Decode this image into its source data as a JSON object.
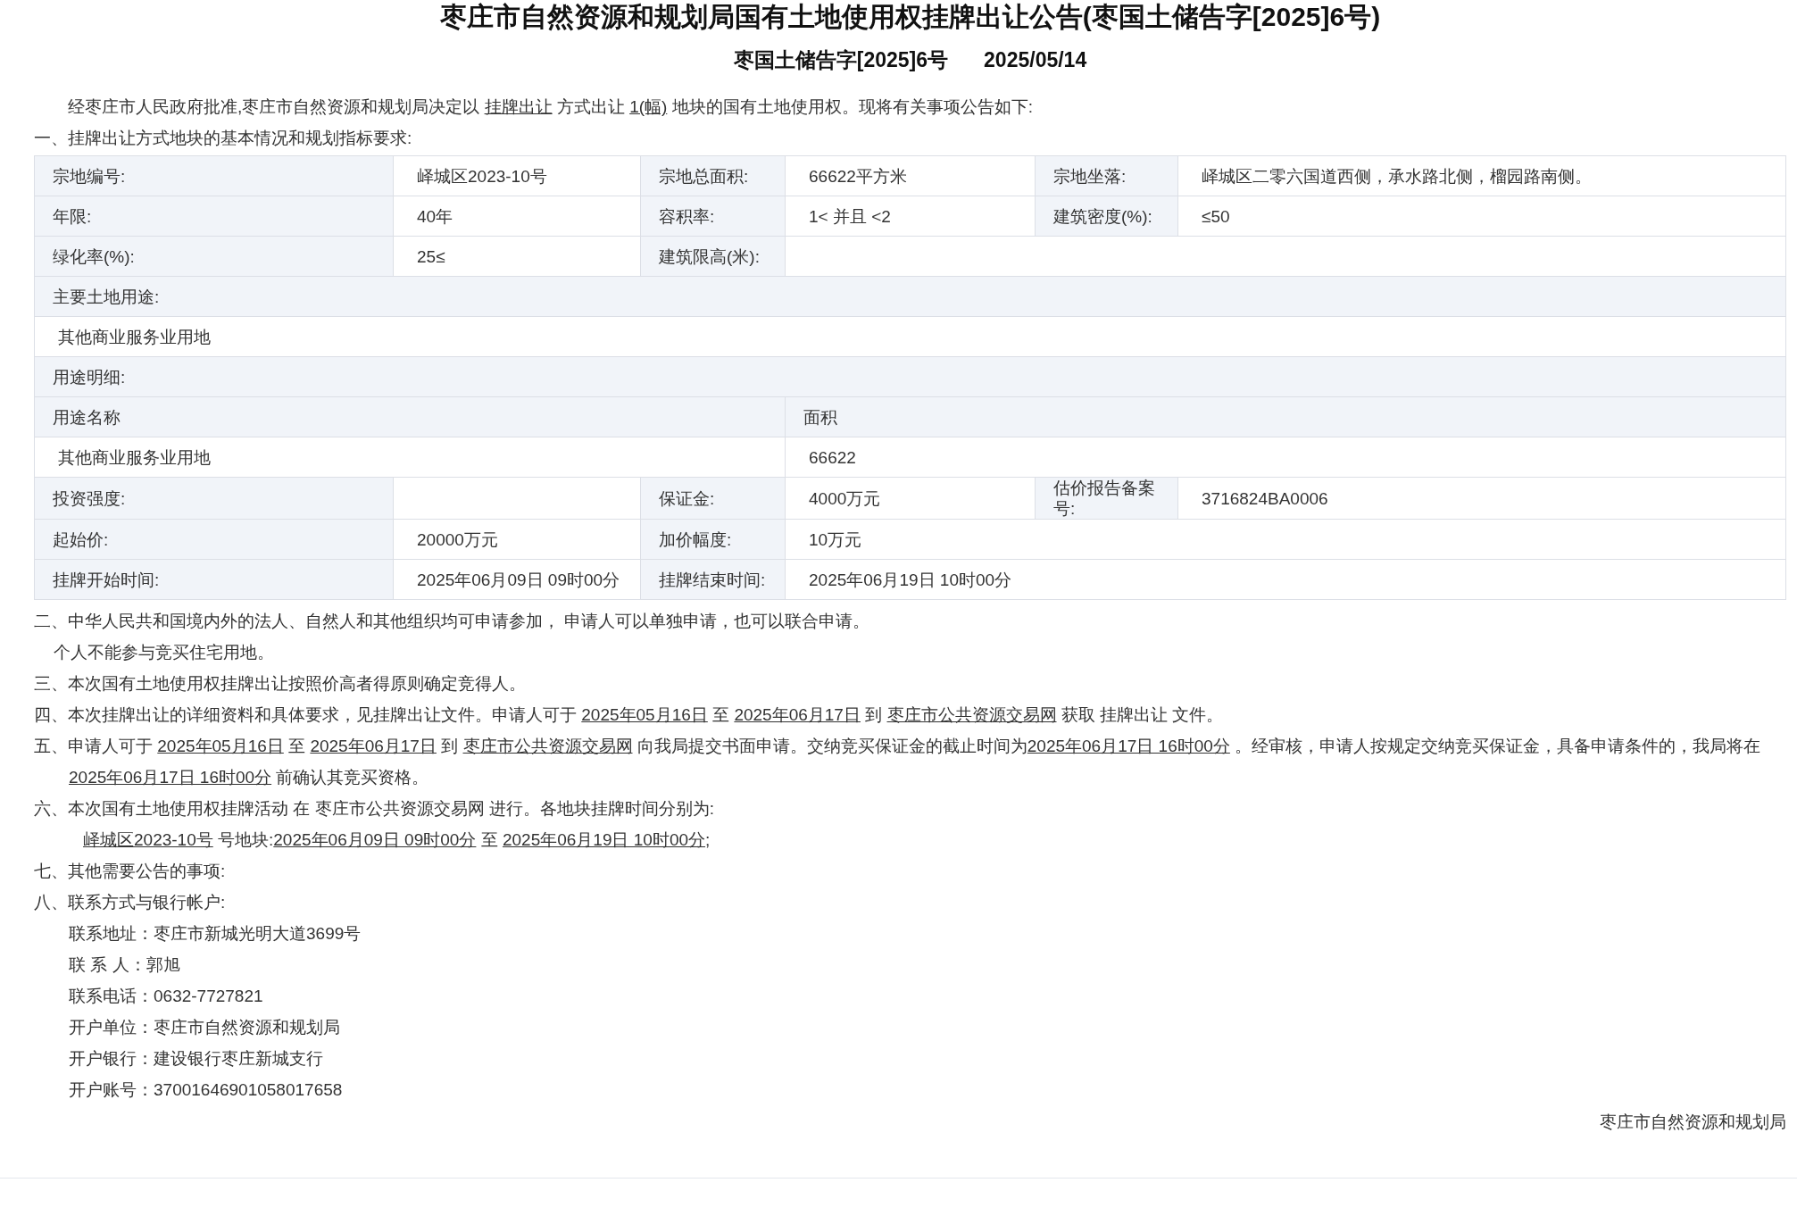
{
  "title": "枣庄市自然资源和规划局国有土地使用权挂牌出让公告(枣国土储告字[2025]6号)",
  "subtitle": {
    "doc_no": "枣国土储告字[2025]6号",
    "date": "2025/05/14"
  },
  "intro": [
    {
      "kind": "plain",
      "text": "经枣庄市人民政府批准,枣庄市自然资源和规划局决定以 "
    },
    {
      "kind": "link",
      "text": "挂牌出让"
    },
    {
      "kind": "plain",
      "text": " 方式出让 "
    },
    {
      "kind": "link",
      "text": "1(幅)"
    },
    {
      "kind": "plain",
      "text": " 地块的国有土地使用权。现将有关事项公告如下:"
    }
  ],
  "section_heading": "一、挂牌出让方式地块的基本情况和规划指标要求:",
  "table": {
    "rows": [
      [
        {
          "kind": "label",
          "text": "宗地编号:"
        },
        {
          "kind": "value",
          "text": "峄城区2023-10号"
        },
        {
          "kind": "label",
          "text": "宗地总面积:"
        },
        {
          "kind": "value",
          "text": "66622平方米"
        },
        {
          "kind": "label",
          "text": "宗地坐落:"
        },
        {
          "kind": "value",
          "text": "峄城区二零六国道西侧，承水路北侧，榴园路南侧。"
        }
      ],
      [
        {
          "kind": "label",
          "text": "年限:"
        },
        {
          "kind": "value",
          "text": "40年"
        },
        {
          "kind": "label",
          "text": "容积率:"
        },
        {
          "kind": "value",
          "text": "1< 并且 <2"
        },
        {
          "kind": "label",
          "text": "建筑密度(%):"
        },
        {
          "kind": "value",
          "text": "≤50"
        }
      ],
      [
        {
          "kind": "label",
          "text": "绿化率(%):"
        },
        {
          "kind": "value",
          "text": "25≤"
        },
        {
          "kind": "label",
          "text": "建筑限高(米):"
        },
        {
          "kind": "value",
          "colspan": 3
        }
      ],
      [
        {
          "kind": "label",
          "text": "主要土地用途:",
          "colspan": 6
        }
      ],
      [
        {
          "kind": "value",
          "text": "其他商业服务业用地",
          "colspan": 6
        }
      ],
      [
        {
          "kind": "label",
          "text": "用途明细:",
          "colspan": 6
        }
      ],
      [
        {
          "kind": "label",
          "text": "用途名称",
          "colspan": 3
        },
        {
          "kind": "label",
          "text": "面积",
          "colspan": 3
        }
      ],
      [
        {
          "kind": "value",
          "text": "其他商业服务业用地",
          "colspan": 3
        },
        {
          "kind": "value",
          "text": "66622",
          "colspan": 3
        }
      ],
      [
        {
          "kind": "label",
          "text": "投资强度:"
        },
        {
          "kind": "value"
        },
        {
          "kind": "label",
          "text": "保证金:"
        },
        {
          "kind": "value",
          "text": "4000万元"
        },
        {
          "kind": "label",
          "text": "估价报告备案号:"
        },
        {
          "kind": "value",
          "text": "3716824BA0006"
        }
      ],
      [
        {
          "kind": "label",
          "text": "起始价:"
        },
        {
          "kind": "value",
          "text": "20000万元"
        },
        {
          "kind": "label",
          "text": "加价幅度:"
        },
        {
          "kind": "value",
          "text": "10万元",
          "colspan": 3
        }
      ],
      [
        {
          "kind": "label",
          "text": "挂牌开始时间:"
        },
        {
          "kind": "value",
          "text": "2025年06月09日 09时00分"
        },
        {
          "kind": "label",
          "text": "挂牌结束时间:"
        },
        {
          "kind": "value",
          "text": "2025年06月19日 10时00分",
          "colspan": 3
        }
      ]
    ]
  },
  "sections": [
    {
      "kind": "item",
      "segments": [
        {
          "kind": "plain",
          "text": "二、中华人民共和国境内外的法人、自然人和其他组织均可申请参加， 申请人可以单独申请，也可以联合申请。"
        }
      ]
    },
    {
      "kind": "note",
      "segments": [
        {
          "kind": "plain",
          "text": "个人不能参与竞买住宅用地。"
        }
      ]
    },
    {
      "kind": "item",
      "segments": [
        {
          "kind": "plain",
          "text": "三、本次国有土地使用权挂牌出让按照价高者得原则确定竞得人。"
        }
      ]
    },
    {
      "kind": "item",
      "segments": [
        {
          "kind": "plain",
          "text": "四、本次挂牌出让的详细资料和具体要求，见挂牌出让文件。申请人可于 "
        },
        {
          "kind": "link",
          "text": "2025年05月16日"
        },
        {
          "kind": "plain",
          "text": " 至 "
        },
        {
          "kind": "link",
          "text": "2025年06月17日"
        },
        {
          "kind": "plain",
          "text": " 到 "
        },
        {
          "kind": "link",
          "text": "枣庄市公共资源交易网"
        },
        {
          "kind": "plain",
          "text": " 获取 挂牌出让 文件。"
        }
      ]
    },
    {
      "kind": "item",
      "segments": [
        {
          "kind": "plain",
          "text": "五、申请人可于 "
        },
        {
          "kind": "link",
          "text": "2025年05月16日"
        },
        {
          "kind": "plain",
          "text": " 至 "
        },
        {
          "kind": "link",
          "text": "2025年06月17日"
        },
        {
          "kind": "plain",
          "text": " 到 "
        },
        {
          "kind": "link",
          "text": "枣庄市公共资源交易网"
        },
        {
          "kind": "plain",
          "text": " 向我局提交书面申请。交纳竞买保证金的截止时间为"
        },
        {
          "kind": "link",
          "text": "2025年06月17日 16时00分"
        },
        {
          "kind": "plain",
          "text": " 。经审核，申请人按规定交纳竞买保证金，具备申请条件的，我局将在 "
        },
        {
          "kind": "link",
          "text": "2025年06月17日 16时00分"
        },
        {
          "kind": "plain",
          "text": " 前确认其竞买资格。"
        }
      ]
    },
    {
      "kind": "item",
      "segments": [
        {
          "kind": "plain",
          "text": "六、本次国有土地使用权挂牌活动 在 枣庄市公共资源交易网 进行。各地块挂牌时间分别为:"
        }
      ]
    },
    {
      "kind": "schedule",
      "segments": [
        {
          "kind": "link",
          "text": "峄城区2023-10号"
        },
        {
          "kind": "plain",
          "text": " 号地块:"
        },
        {
          "kind": "link",
          "text": "2025年06月09日 09时00分"
        },
        {
          "kind": "plain",
          "text": " 至 "
        },
        {
          "kind": "link",
          "text": "2025年06月19日 10时00分"
        },
        {
          "kind": "plain",
          "text": ";"
        }
      ]
    },
    {
      "kind": "item",
      "segments": [
        {
          "kind": "plain",
          "text": "七、其他需要公告的事项:"
        }
      ]
    },
    {
      "kind": "item",
      "segments": [
        {
          "kind": "plain",
          "text": "八、联系方式与银行帐户:"
        }
      ]
    }
  ],
  "contacts": [
    "联系地址：枣庄市新城光明大道3699号",
    "联 系 人：郭旭",
    "联系电话：0632-7727821",
    "开户单位：枣庄市自然资源和规划局",
    "开户银行：建设银行枣庄新城支行",
    "开户账号：37001646901058017658"
  ],
  "signature": "枣庄市自然资源和规划局"
}
